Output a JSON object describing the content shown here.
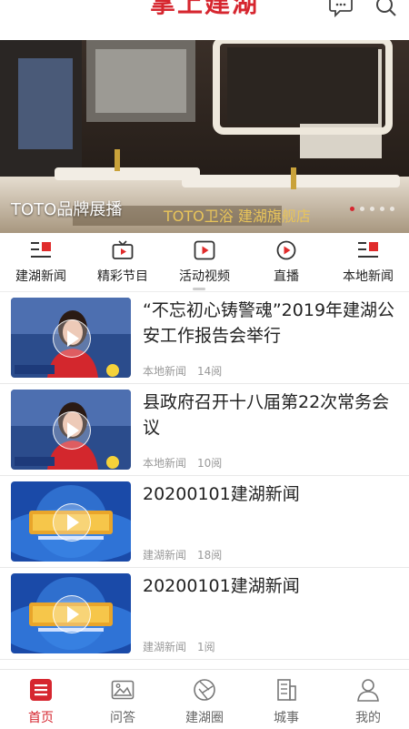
{
  "app": {
    "title": "掌上建湖",
    "accent_color": "#d6262f"
  },
  "header": {
    "icons": [
      "chat-bubble-icon",
      "search-icon"
    ]
  },
  "banner": {
    "caption": "TOTO品牌展播",
    "slide_count": 5,
    "active_slide": 1
  },
  "category_nav": {
    "items": [
      {
        "label": "建湖新闻",
        "icon": "newspaper-icon"
      },
      {
        "label": "精彩节目",
        "icon": "tv-icon"
      },
      {
        "label": "活动视频",
        "icon": "video-play-icon"
      },
      {
        "label": "直播",
        "icon": "live-play-icon"
      },
      {
        "label": "本地新闻",
        "icon": "local-news-icon"
      }
    ]
  },
  "news_list": [
    {
      "headline": "“不忘初心铸警魂”2019年建湖公安工作报告会举行",
      "category": "本地新闻",
      "reads": "14阅",
      "thumb": "anchor"
    },
    {
      "headline": "县政府召开十八届第22次常务会议",
      "category": "本地新闻",
      "reads": "10阅",
      "thumb": "anchor"
    },
    {
      "headline": "20200101建湖新闻",
      "category": "建湖新闻",
      "reads": "18阅",
      "thumb": "logo"
    },
    {
      "headline": "20200101建湖新闻",
      "category": "建湖新闻",
      "reads": "1阅",
      "thumb": "logo"
    }
  ],
  "tab_bar": {
    "active": 0,
    "tabs": [
      {
        "label": "首页",
        "icon": "home-list-icon"
      },
      {
        "label": "问答",
        "icon": "image-frame-icon"
      },
      {
        "label": "建湖圈",
        "icon": "aperture-icon"
      },
      {
        "label": "城事",
        "icon": "building-document-icon"
      },
      {
        "label": "我的",
        "icon": "person-icon"
      }
    ]
  }
}
